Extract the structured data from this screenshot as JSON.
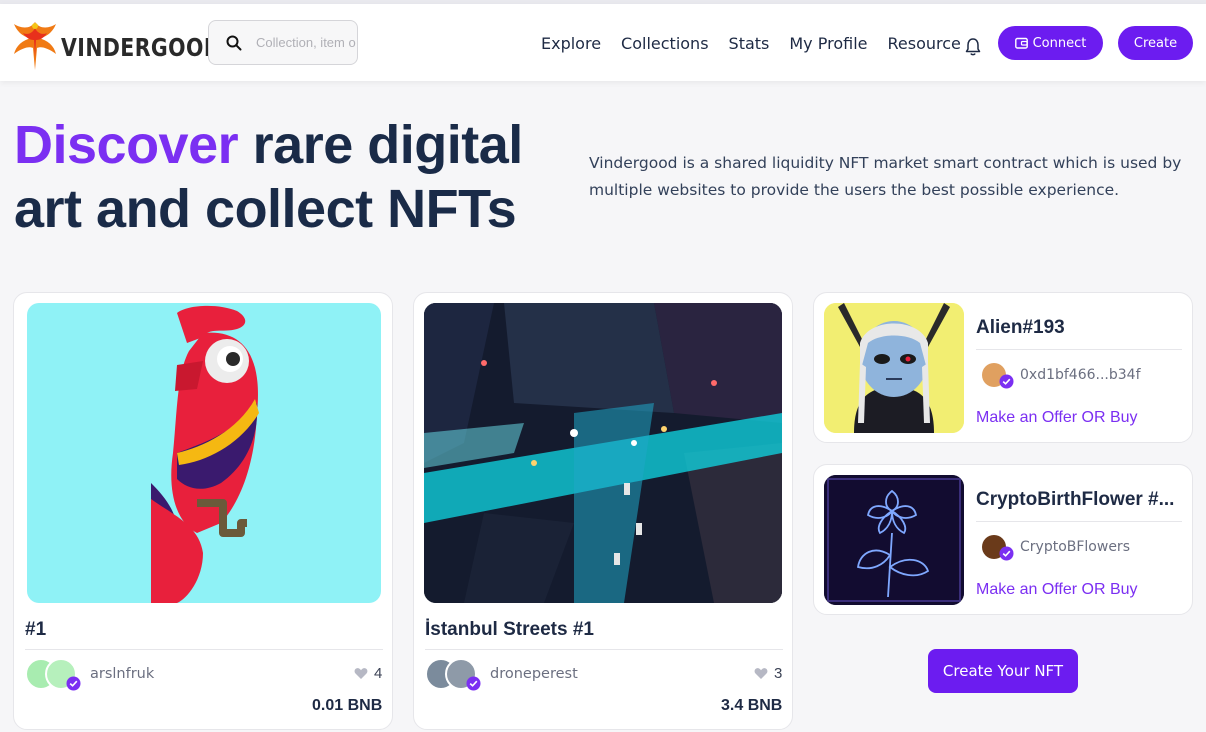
{
  "brand": {
    "name": "VINDERGOOD"
  },
  "search": {
    "placeholder": "Collection, item or user"
  },
  "nav": {
    "items": [
      {
        "label": "Explore"
      },
      {
        "label": "Collections"
      },
      {
        "label": "Stats"
      },
      {
        "label": "My Profile"
      },
      {
        "label": "Resource"
      }
    ],
    "connect_label": "Connect",
    "create_label": "Create"
  },
  "hero": {
    "title_accent": "Discover",
    "title_rest": " rare digital art and collect NFTs",
    "description": "Vindergood is a shared liquidity NFT market smart contract which is used by multiple websites to provide the users the best possible experience."
  },
  "cards": [
    {
      "title": "#1",
      "owner": "arslnfruk",
      "likes": "4",
      "price": "0.01 BNB"
    },
    {
      "title": "İstanbul Streets #1",
      "owner": "droneperest",
      "likes": "3",
      "price": "3.4 BNB"
    }
  ],
  "mini_cards": [
    {
      "title": "Alien#193",
      "owner": "0xd1bf466...b34f",
      "offer": "Make an Offer OR Buy"
    },
    {
      "title": "CryptoBirthFlower #...",
      "owner": "CryptoBFlowers",
      "offer": "Make an Offer OR Buy"
    }
  ],
  "cta": {
    "label": "Create Your NFT"
  },
  "colors": {
    "accent": "#6c1cf0",
    "accent_text": "#7b2ff2",
    "heading": "#1a2b48"
  }
}
